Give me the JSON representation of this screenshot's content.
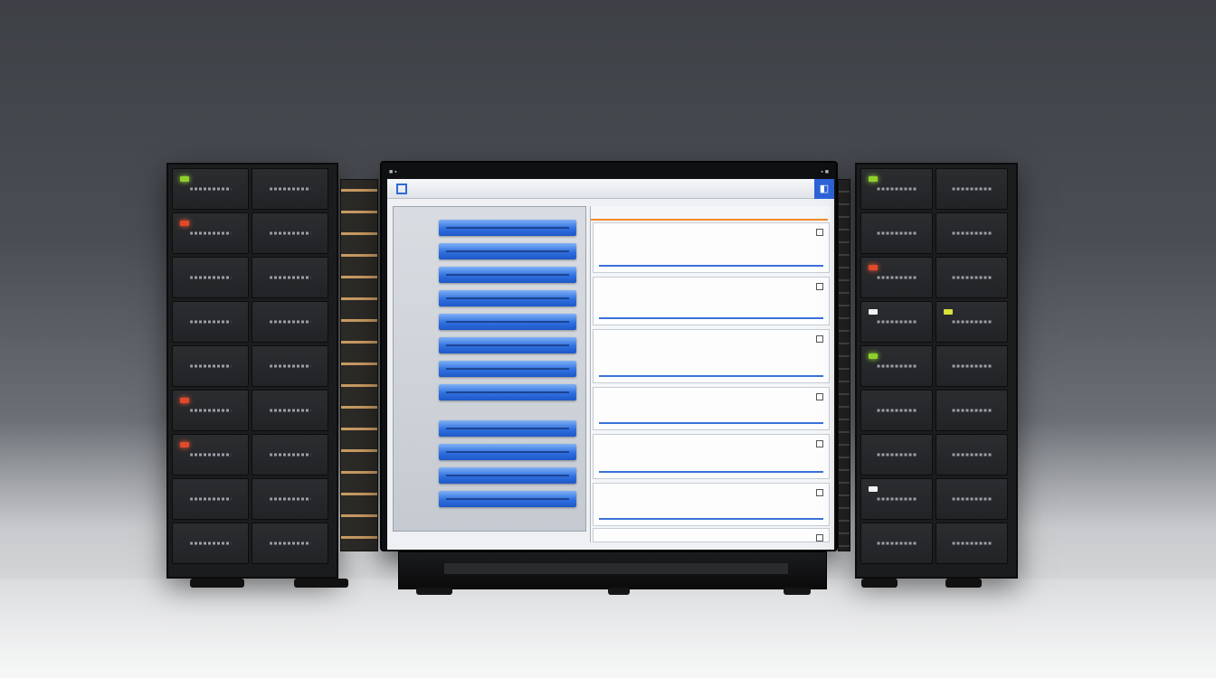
{
  "monitor": {
    "top_center_label": "",
    "app_title": "",
    "menu_items": [
      "",
      "",
      ""
    ],
    "footer_text": ""
  },
  "colors": {
    "accent_blue": "#2f6fe0",
    "led_red": "#e0492b",
    "led_green": "#8fd12c",
    "orange_divider": "#f08a2c"
  },
  "icons": [
    "app-logo-icon",
    "app-action-icon",
    "checkbox-icon"
  ],
  "left_pane": {
    "bar_count": 12
  },
  "right_pane": {
    "card_count": 7
  }
}
